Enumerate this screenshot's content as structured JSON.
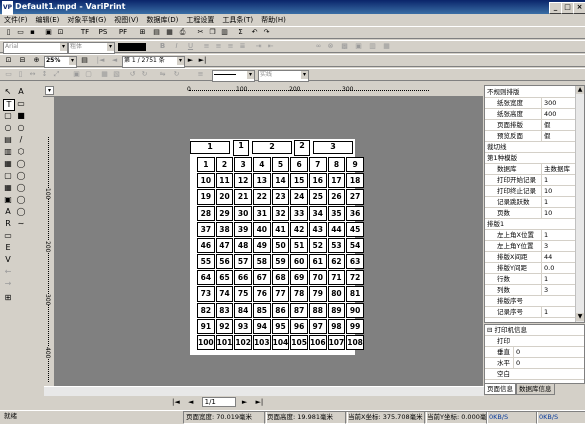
{
  "window": {
    "app_icon": "VP",
    "title": "Default1.mpd - VariPrint",
    "btn_min": "_",
    "btn_max": "□",
    "btn_close": "×"
  },
  "menu": [
    "文件(F)",
    "编辑(E)",
    "对象平铺(G)",
    "视图(V)",
    "数据库(D)",
    "工程设置",
    "工具条(T)",
    "帮助(H)"
  ],
  "toolbar": {
    "font_name": "Arial",
    "font_style": "粗体",
    "zoom": "25%",
    "page_indicator": "第 1 / 2751 条",
    "line_style": "实线"
  },
  "rulers": {
    "h_labels": [
      "0",
      "100",
      "200",
      "300"
    ],
    "v_labels": [
      "100",
      "200",
      "300",
      "400"
    ]
  },
  "page": {
    "header_boxes": [
      "1",
      "1",
      "2",
      "2",
      "3"
    ],
    "rows": [
      [
        "1",
        "2",
        "3",
        "4",
        "5",
        "6",
        "7",
        "8",
        "9"
      ],
      [
        "10",
        "11",
        "12",
        "13",
        "14",
        "15",
        "16",
        "17",
        "18"
      ],
      [
        "19",
        "20",
        "21",
        "22",
        "23",
        "24",
        "25",
        "26",
        "27"
      ],
      [
        "28",
        "29",
        "30",
        "31",
        "32",
        "33",
        "34",
        "35",
        "36"
      ],
      [
        "37",
        "38",
        "39",
        "40",
        "41",
        "42",
        "43",
        "44",
        "45"
      ],
      [
        "46",
        "47",
        "48",
        "49",
        "50",
        "51",
        "52",
        "53",
        "54"
      ],
      [
        "55",
        "56",
        "57",
        "58",
        "59",
        "60",
        "61",
        "62",
        "63"
      ],
      [
        "64",
        "65",
        "66",
        "67",
        "68",
        "69",
        "70",
        "71",
        "72"
      ],
      [
        "73",
        "74",
        "75",
        "76",
        "77",
        "78",
        "79",
        "80",
        "81"
      ],
      [
        "82",
        "83",
        "84",
        "85",
        "86",
        "87",
        "88",
        "89",
        "90"
      ],
      [
        "91",
        "92",
        "93",
        "94",
        "95",
        "96",
        "97",
        "98",
        "99"
      ],
      [
        "100",
        "101",
        "102",
        "103",
        "104",
        "105",
        "106",
        "107",
        "108"
      ]
    ]
  },
  "pager": {
    "first": "|◄",
    "prev": "◄",
    "value": "1/1",
    "next": "►",
    "last": "►|"
  },
  "properties": {
    "rows": [
      {
        "name": "不规则排版",
        "value": "",
        "group": true
      },
      {
        "name": "纸张宽度",
        "value": "300"
      },
      {
        "name": "纸张高度",
        "value": "400"
      },
      {
        "name": "页面排版",
        "value": "假"
      },
      {
        "name": "预览反面",
        "value": "假"
      },
      {
        "name": "裁切线",
        "value": "",
        "group": true
      },
      {
        "name": "第1种模版",
        "value": "",
        "group": true
      },
      {
        "name": "数据库",
        "value": "主数据库"
      },
      {
        "name": "打印开始记录",
        "value": "1"
      },
      {
        "name": "打印终止记录",
        "value": "10"
      },
      {
        "name": "记录跳跃数",
        "value": "1"
      },
      {
        "name": "页数",
        "value": "10"
      },
      {
        "name": "排版1",
        "value": "",
        "group": true
      },
      {
        "name": "左上角X位置",
        "value": "1"
      },
      {
        "name": "左上角Y位置",
        "value": "3"
      },
      {
        "name": "排版X间距",
        "value": "44"
      },
      {
        "name": "排版Y间距",
        "value": "0.0"
      },
      {
        "name": "行数",
        "value": "1"
      },
      {
        "name": "列数",
        "value": "3"
      },
      {
        "name": "排版序号",
        "value": ""
      },
      {
        "name": "记录序号",
        "value": "1"
      }
    ]
  },
  "printer_panel": {
    "title": "打印机信息",
    "rows": [
      "打印",
      "垂直",
      "水平",
      "空白"
    ],
    "values": [
      "",
      "0",
      "0",
      ""
    ]
  },
  "bottom_tabs": [
    "页面信息",
    "数据库信息"
  ],
  "status": {
    "ready": "就绪",
    "page_width": "页面宽度: 70.019毫米",
    "page_height": "页面高度: 19.981毫米",
    "cursor_x": "当前X坐标: 375.708毫米",
    "cursor_y": "当前Y坐标: 0.000毫米",
    "net_down": "0KB/S",
    "net_up": "0KB/S"
  }
}
